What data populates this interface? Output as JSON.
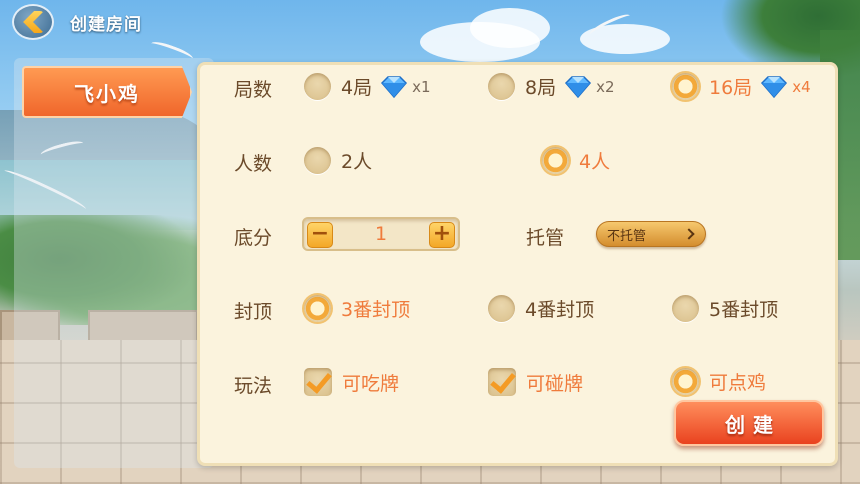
{
  "header": {
    "title": "创建房间"
  },
  "side_tab": {
    "label": "飞小鸡"
  },
  "rounds": {
    "label": "局数",
    "options": [
      {
        "label": "4局",
        "cost": "x1",
        "selected": false
      },
      {
        "label": "8局",
        "cost": "x2",
        "selected": false
      },
      {
        "label": "16局",
        "cost": "x4",
        "selected": true
      }
    ]
  },
  "players": {
    "label": "人数",
    "options": [
      {
        "label": "2人",
        "selected": false
      },
      {
        "label": "4人",
        "selected": true
      }
    ]
  },
  "base_score": {
    "label": "底分",
    "value": "1",
    "minus": "−",
    "plus": "+"
  },
  "trustee": {
    "label": "托管",
    "value": "不托管"
  },
  "cap": {
    "label": "封顶",
    "options": [
      {
        "label": "3番封顶",
        "selected": true
      },
      {
        "label": "4番封顶",
        "selected": false
      },
      {
        "label": "5番封顶",
        "selected": false
      }
    ]
  },
  "rules": {
    "label": "玩法",
    "options": [
      {
        "label": "可吃牌",
        "checked": true
      },
      {
        "label": "可碰牌",
        "checked": true
      },
      {
        "label": "可点鸡",
        "checked": false
      }
    ]
  },
  "create_button": {
    "label": "创建"
  },
  "colors": {
    "accent": "#ef7b3c",
    "text": "#6b4a2a",
    "panel": "#fbf3dd"
  }
}
